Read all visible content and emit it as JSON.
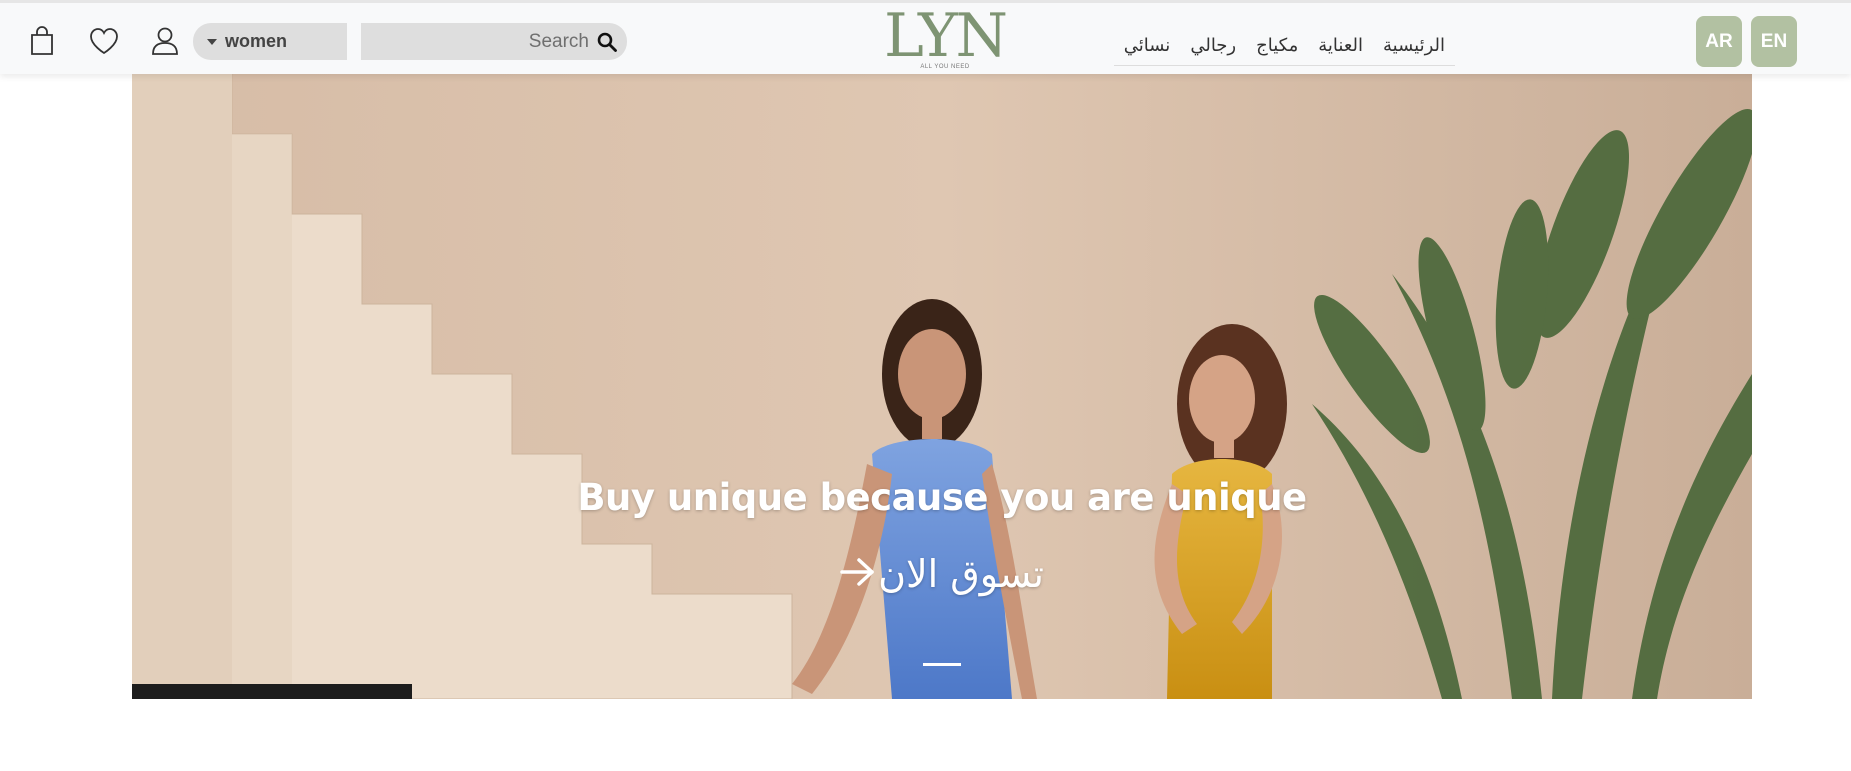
{
  "header": {
    "category": {
      "selected": "women"
    },
    "search": {
      "placeholder": "Search"
    },
    "logo": {
      "mark": "LYN",
      "tagline": "ALL YOU NEED"
    },
    "nav": [
      {
        "label": "الرئيسية"
      },
      {
        "label": "العناية"
      },
      {
        "label": "مكياج"
      },
      {
        "label": "رجالي"
      },
      {
        "label": "نسائي"
      }
    ],
    "languages": {
      "ar": "AR",
      "en": "EN"
    },
    "icons": [
      "shopping-bag-icon",
      "heart-icon",
      "user-icon",
      "search-icon"
    ]
  },
  "hero": {
    "headline": "Buy unique because you are unique",
    "cta_label": "تسوق الان",
    "cta_arrow": "🡒"
  },
  "colors": {
    "accent": "#b2c1a2",
    "logo": "#7e9473",
    "header_bg": "#f8f9fa",
    "input_bg": "#dedede"
  }
}
